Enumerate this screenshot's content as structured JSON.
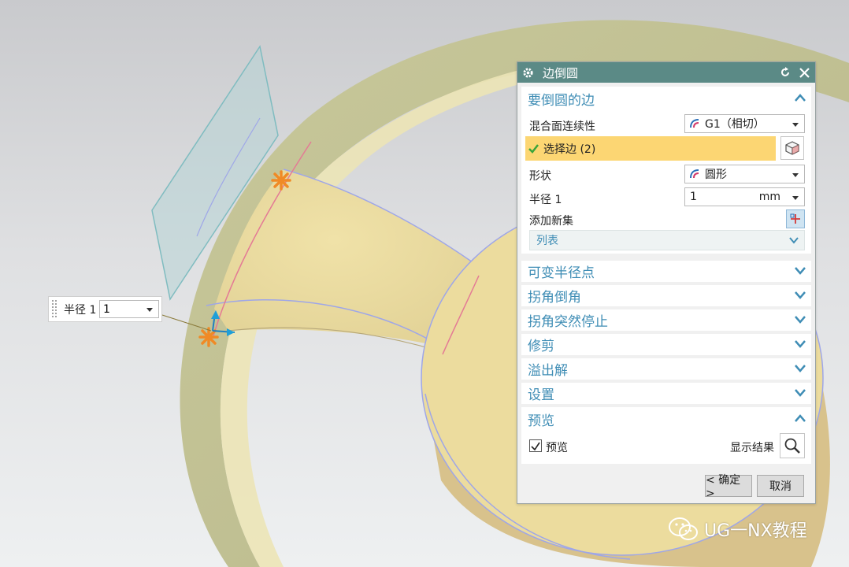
{
  "dialog": {
    "title": "边倒圆",
    "sections": {
      "edges_to_blend": "要倒圆的边",
      "variable_radius_points": "可变半径点",
      "corner_setback": "拐角倒角",
      "stop_short_of_corner": "拐角突然停止",
      "trim": "修剪",
      "overflow": "溢出解",
      "settings": "设置",
      "preview": "预览"
    },
    "blend_continuity": {
      "label": "混合面连续性",
      "value": "G1（相切）"
    },
    "select_edge": {
      "label": "选择边 (2)"
    },
    "shape": {
      "label": "形状",
      "value": "圆形"
    },
    "radius": {
      "label": "半径 1",
      "value": "1",
      "unit": "mm"
    },
    "add_new_set": {
      "label": "添加新集"
    },
    "list": {
      "label": "列表"
    },
    "preview_checkbox": {
      "label": "预览",
      "checked": true
    },
    "show_result": {
      "label": "显示结果"
    },
    "buttons": {
      "ok": "< 确定 >",
      "cancel": "取消"
    }
  },
  "radius_callout": {
    "label": "半径 1",
    "value": "1"
  },
  "watermark": {
    "text": "UG一NX教程"
  },
  "colors": {
    "titlebar": "#5b8a86",
    "section_text": "#3f8db5",
    "selected_row": "#fcd673",
    "part_face": "#eadb9c"
  }
}
